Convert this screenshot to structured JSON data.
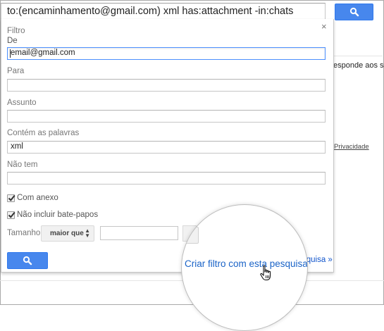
{
  "search": {
    "query": "to:(encaminhamento@gmail.com) xml has:attachment -in:chats"
  },
  "background": {
    "partial_text": "esponde aos se",
    "privacy_link": "Privacidade"
  },
  "filter": {
    "title": "Filtro",
    "close_symbol": "×",
    "from_label": "De",
    "from_value": "email@gmail.com",
    "to_label": "Para",
    "to_value": "",
    "subject_label": "Assunto",
    "subject_value": "",
    "has_words_label": "Contém as palavras",
    "has_words_value": "xml",
    "doesnt_have_label": "Não tem",
    "doesnt_have_value": "",
    "has_attachment_label": "Com anexo",
    "has_attachment_checked": true,
    "exclude_chats_label": "Não incluir bate-papos",
    "exclude_chats_checked": true,
    "size_label": "Tamanho",
    "size_operator": "maior que",
    "size_value": "",
    "create_filter_link": "Criar filtro com esta pesquisa",
    "create_filter_link_tail": "squisa »"
  },
  "colors": {
    "primary_button": "#4787ed",
    "link": "#1155cc",
    "focus_border": "#4d90fe"
  },
  "icons": {
    "search": "search-icon",
    "close": "close-icon",
    "cursor": "hand-pointer-icon"
  }
}
